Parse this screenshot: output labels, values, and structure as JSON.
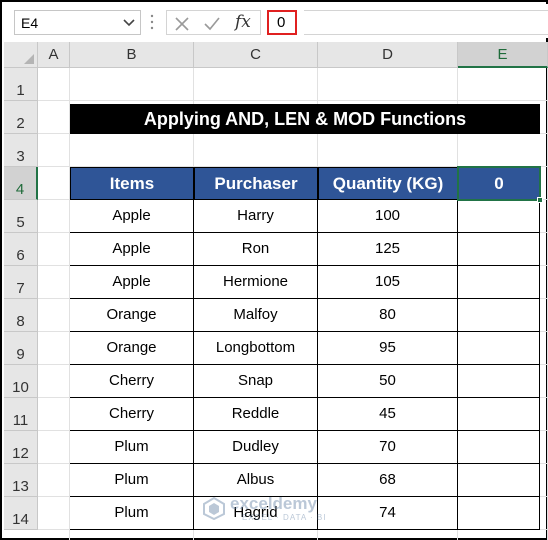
{
  "formula_bar": {
    "name_box": "E4",
    "fx_label": "fx",
    "value": "0"
  },
  "columns": [
    "A",
    "B",
    "C",
    "D",
    "E"
  ],
  "rows": [
    "1",
    "2",
    "3",
    "4",
    "5",
    "6",
    "7",
    "8",
    "9",
    "10",
    "11",
    "12",
    "13",
    "14"
  ],
  "sheet": {
    "title": "Applying AND, LEN & MOD Functions",
    "headers": [
      "Items",
      "Purchaser",
      "Quantity (KG)",
      "0"
    ],
    "data": [
      [
        "Apple",
        "Harry",
        "100",
        ""
      ],
      [
        "Apple",
        "Ron",
        "125",
        ""
      ],
      [
        "Apple",
        "Hermione",
        "105",
        ""
      ],
      [
        "Orange",
        "Malfoy",
        "80",
        ""
      ],
      [
        "Orange",
        "Longbottom",
        "95",
        ""
      ],
      [
        "Cherry",
        "Snap",
        "50",
        ""
      ],
      [
        "Cherry",
        "Reddle",
        "45",
        ""
      ],
      [
        "Plum",
        "Dudley",
        "70",
        ""
      ],
      [
        "Plum",
        "Albus",
        "68",
        ""
      ],
      [
        "Plum",
        "Hagrid",
        "74",
        ""
      ]
    ]
  },
  "selection": {
    "cell": "E4",
    "column": "E",
    "row": "4"
  },
  "watermark": {
    "name": "exceldemy",
    "tagline": "EXCEL · DATA · BI"
  },
  "colors": {
    "header_fill": "#2f5597",
    "title_fill": "#000000",
    "selection": "#217346",
    "formula_highlight": "#e02020"
  }
}
